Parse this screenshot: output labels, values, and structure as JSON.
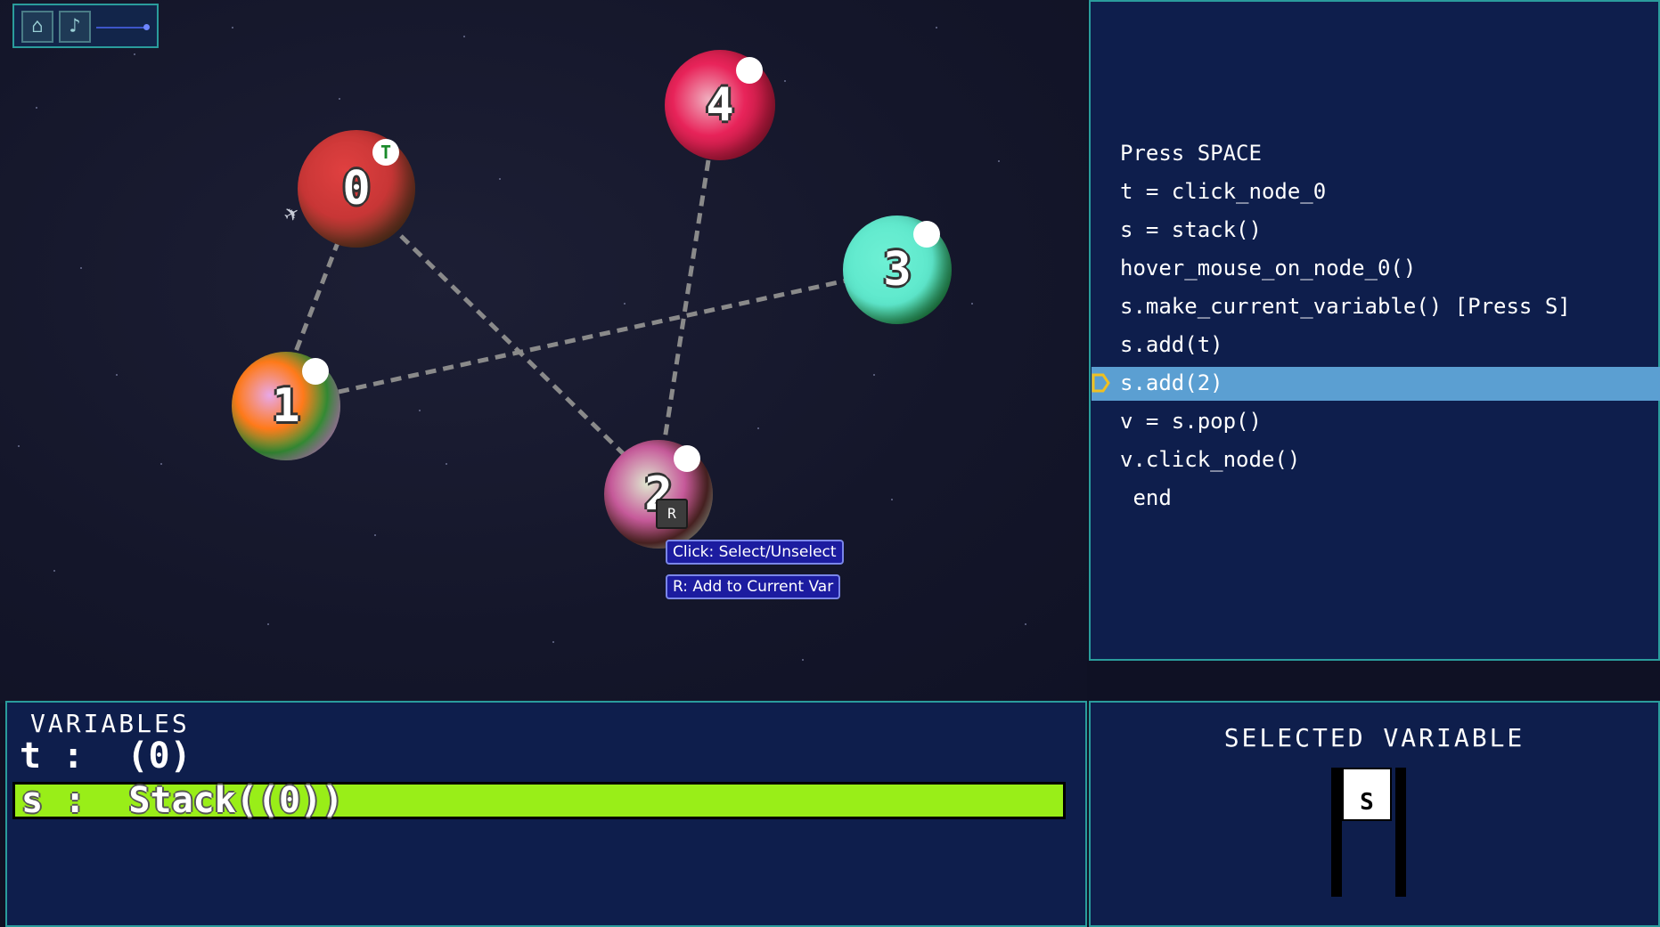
{
  "toolbar": {
    "home_icon": "home-icon",
    "sound_icon": "speaker-icon"
  },
  "nodes": [
    {
      "id": "0",
      "label": "0",
      "colors": [
        "#d63a3a",
        "#6b3a22"
      ],
      "badge": "T",
      "badge_color": "#1a8a2a"
    },
    {
      "id": "1",
      "label": "1",
      "colors": [
        "#e8a8e8",
        "#ff7a1a",
        "#3a9a3a"
      ]
    },
    {
      "id": "2",
      "label": "2",
      "colors": [
        "#e0e8d0",
        "#c65a9a",
        "#5a2a2a"
      ],
      "key": "R"
    },
    {
      "id": "3",
      "label": "3",
      "colors": [
        "#5ee8cc",
        "#1a8a3a"
      ]
    },
    {
      "id": "4",
      "label": "4",
      "colors": [
        "#e8245a",
        "#f0b0c0",
        "#5a1a2a"
      ]
    }
  ],
  "edges": [
    [
      "0",
      "1"
    ],
    [
      "0",
      "2"
    ],
    [
      "1",
      "3"
    ],
    [
      "4",
      "2"
    ]
  ],
  "tooltips": {
    "click": "Click: Select/Unselect",
    "r": "R: Add to Current Var"
  },
  "code": {
    "lines": [
      "Press SPACE",
      "t = click_node_0",
      "s = stack()",
      "hover_mouse_on_node_0()",
      "s.make_current_variable() [Press S]",
      "s.add(t)",
      "s.add(2)",
      "v = s.pop()",
      "v.click_node()",
      " end"
    ],
    "current_line": 6
  },
  "variables": {
    "title": "VARIABLES",
    "t_row": "t :  (0)",
    "s_row": "s :  Stack((0))",
    "highlight_color": "#99ee18"
  },
  "selected": {
    "title": "SELECTED VARIABLE",
    "item": "S"
  }
}
